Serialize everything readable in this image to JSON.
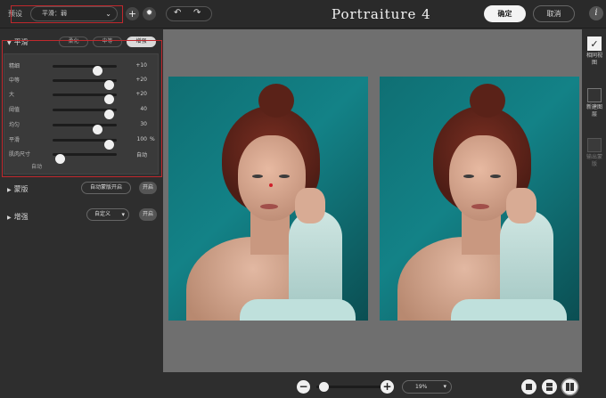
{
  "topbar": {
    "preset_label": "预设",
    "preset_value": "平滑：弱",
    "add_icon": "plus-icon",
    "settings_icon": "gear-icon",
    "app_title": "Portraiture 4",
    "ok_label": "确定",
    "cancel_label": "取消",
    "info_label": "i"
  },
  "smoothing": {
    "title": "平滑",
    "modes": [
      "柔化",
      "中等",
      "增强"
    ],
    "active_mode": "增强",
    "sliders": [
      {
        "label": "精细",
        "value": "+10",
        "unit": "",
        "level": 0.73
      },
      {
        "label": "中等",
        "value": "+20",
        "unit": "",
        "level": 0.95
      },
      {
        "label": "大",
        "value": "+20",
        "unit": "",
        "level": 0.95
      },
      {
        "label": "阈值",
        "value": "40",
        "unit": "",
        "level": 0.95
      },
      {
        "label": "均匀",
        "value": "30",
        "unit": "",
        "level": 0.73
      },
      {
        "label": "平滑",
        "value": "100",
        "unit": "%",
        "level": 0.95
      },
      {
        "label": "肌肉尺寸",
        "value": "自动",
        "unit": "",
        "level": 0.05
      }
    ],
    "auto_label": "自动"
  },
  "mask": {
    "title": "蒙版",
    "auto_mask_label": "自动蒙版开启",
    "toggle_label": "开启"
  },
  "enhance": {
    "title": "增强",
    "custom_label": "自定义",
    "toggle_label": "开启"
  },
  "right_rail": {
    "items": [
      {
        "label": "相同视图",
        "checked": true
      },
      {
        "label": "新建图层",
        "checked": false
      },
      {
        "label": "输出蒙版",
        "checked": false
      }
    ]
  },
  "bottombar": {
    "zoom_out": "−",
    "zoom_in": "+",
    "zoom_value": "19%",
    "zoom_level": 0.05
  },
  "colors": {
    "accent_red": "#c0282d",
    "panel": "#2e2e2e",
    "canvas": "#6f6f6f",
    "photo_bg": "#138287"
  }
}
